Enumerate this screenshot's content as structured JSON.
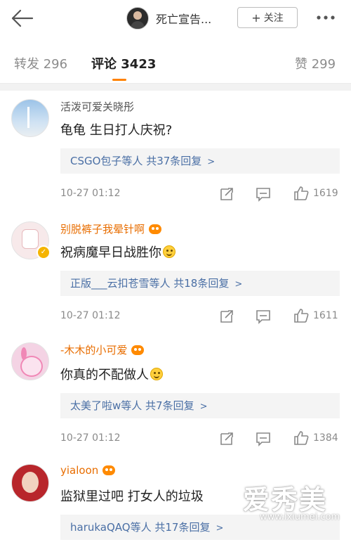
{
  "header": {
    "title": "死亡宣告...",
    "follow_plus": "+",
    "follow_label": "关注"
  },
  "tabs": [
    {
      "label": "转发 296"
    },
    {
      "label": "评论 3423"
    },
    {
      "label": "赞 299"
    }
  ],
  "comments": [
    {
      "username": "活泼可爱关晓彤",
      "text": "龟龟 生日打人庆祝?",
      "replies": "CSGO包子等人 共37条回复",
      "time": "10-27 01:12",
      "likes": "1619"
    },
    {
      "username": "别脱裤子我晕针啊",
      "text": "祝病魔早日战胜你",
      "replies": "正版___云扣苍雪等人 共18条回复",
      "time": "10-27 01:12",
      "likes": "1611"
    },
    {
      "username": "-木木的小可爱",
      "text": "你真的不配做人",
      "replies": "太美了啦w等人 共7条回复",
      "time": "10-27 01:12",
      "likes": "1384"
    },
    {
      "username": "yialoon",
      "text": "监狱里过吧 打女人的垃圾",
      "replies": "harukaQAQ等人 共17条回复"
    }
  ],
  "icons": {
    "back": "arrow-left-icon",
    "more": "more-dots-icon",
    "repost": "repost-icon",
    "comment": "comment-icon",
    "like": "thumbs-up-icon",
    "vip": "vip-crown-icon",
    "emoji": "smile-emoji-icon"
  },
  "colors": {
    "accent": "#ff8200",
    "vip_name": "#e86d00",
    "reply_link": "#4a6fa5"
  },
  "watermark": {
    "text": "爱秀美",
    "url": "www.ixiumei.com"
  }
}
